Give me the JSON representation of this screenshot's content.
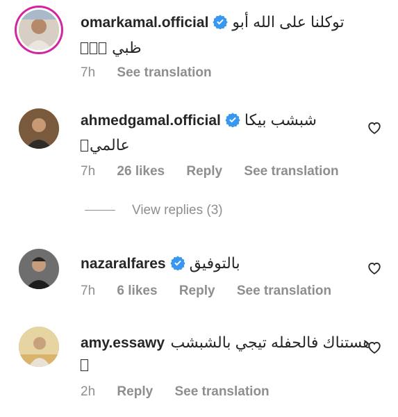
{
  "comments": [
    {
      "username": "omarkamal.official",
      "verified": true,
      "text": "توكلنا على الله أبو",
      "text2": "ظبي",
      "text2_prefix_boxes": 3,
      "time": "7h",
      "likes": "",
      "reply": "",
      "see_translation": "See translation",
      "heart": false
    },
    {
      "username": "ahmedgamal.official",
      "verified": true,
      "text": "شبشب بيكا",
      "text2": "عالمي",
      "text2_prefix_boxes": 1,
      "time": "7h",
      "likes": "26 likes",
      "reply": "Reply",
      "see_translation": "See translation",
      "heart": true
    },
    {
      "username": "nazaralfares",
      "verified": true,
      "text": "بالتوفيق",
      "text2": "",
      "time": "7h",
      "likes": "6 likes",
      "reply": "Reply",
      "see_translation": "See translation",
      "heart": true
    },
    {
      "username": "amy.essawy",
      "verified": false,
      "text": "هستناك فالحفله تيجي بالشبشب",
      "text2": "",
      "text2_prefix_boxes": 1,
      "time": "2h",
      "likes": "",
      "reply": "Reply",
      "see_translation": "See translation",
      "heart": true
    }
  ],
  "view_replies": "View replies (3)",
  "colors": {
    "verified": "#3897f0",
    "muted": "#8e8e8e",
    "story_ring": "#d6249f"
  },
  "icons": {
    "verified": "verified-badge-icon",
    "like": "heart-outline-icon"
  }
}
